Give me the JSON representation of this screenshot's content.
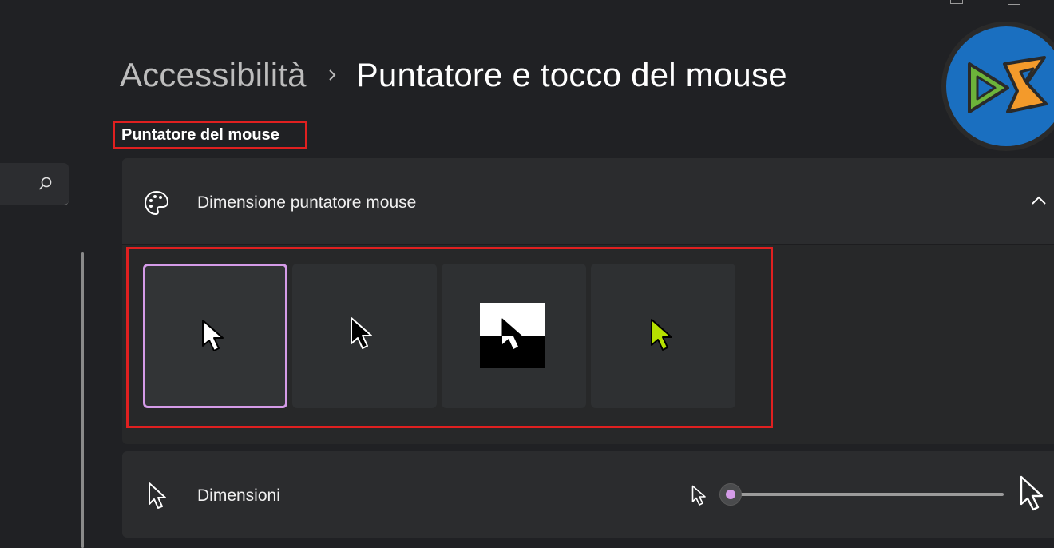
{
  "window": {
    "controls": [
      "minimize",
      "maximize"
    ]
  },
  "breadcrumb": {
    "parent": "Accessibilità",
    "current": "Puntatore e tocco del mouse"
  },
  "section": {
    "heading": "Puntatore del mouse"
  },
  "pointer_style_card": {
    "label": "Dimensione puntatore mouse",
    "icon": "palette-icon",
    "expanded": true,
    "options": [
      {
        "name": "white",
        "selected": true
      },
      {
        "name": "black",
        "selected": false
      },
      {
        "name": "inverted",
        "selected": false
      },
      {
        "name": "custom",
        "color": "#b6e000",
        "selected": false
      }
    ]
  },
  "size_card": {
    "label": "Dimensioni",
    "icon": "pointer-icon",
    "slider_value_fraction": 0.0
  },
  "colors": {
    "accent": "#d49be8",
    "highlight_frame": "#e02020",
    "custom_pointer": "#b6e000"
  }
}
